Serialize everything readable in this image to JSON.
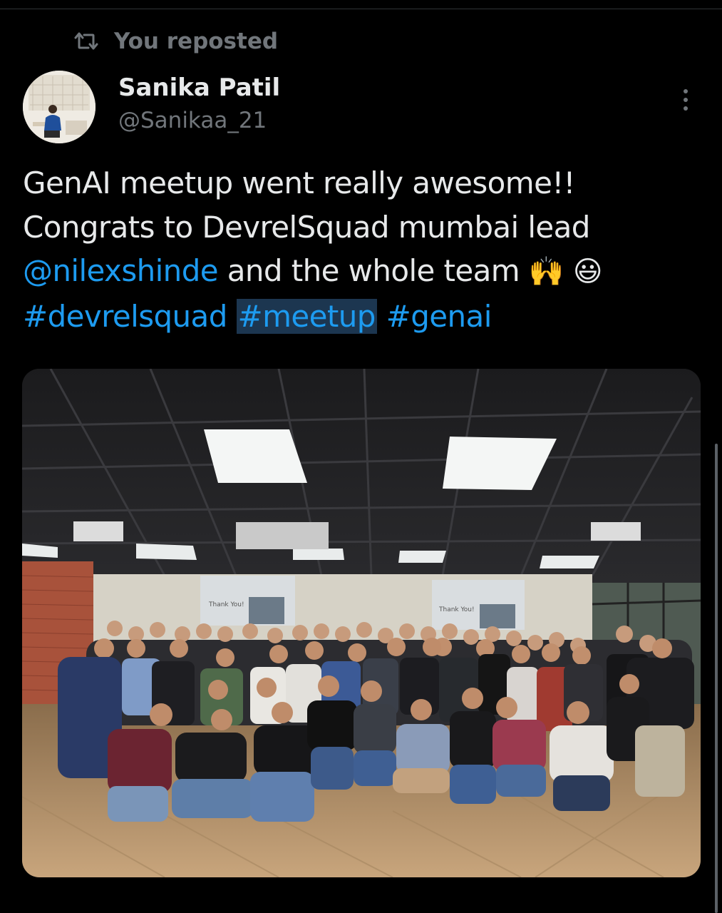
{
  "repost": {
    "label": "You reposted",
    "icon": "repost-icon"
  },
  "author": {
    "display_name": "Sanika Patil",
    "handle": "@Sanikaa_21",
    "avatar_icon": "avatar"
  },
  "menu": {
    "icon": "more-options-icon"
  },
  "tweet": {
    "line1": "GenAI meetup went really awesome!!",
    "line2": "Congrats to DevrelSquad mumbai lead",
    "mention": "@nilexshinde",
    "line3_rest": " and the whole team ",
    "emoji_hands": "🙌",
    "emoji_smile": "😃",
    "hashtags": [
      "#devrelsquad",
      "#meetup",
      "#genai"
    ]
  },
  "media": {
    "screen_left_text": "Thank You!",
    "screen_right_text": "Thank You!"
  },
  "colors": {
    "background": "#000000",
    "text_primary": "#e7e9ea",
    "text_secondary": "#71767b",
    "link": "#1d9bf0",
    "highlight": "#1c3650"
  }
}
